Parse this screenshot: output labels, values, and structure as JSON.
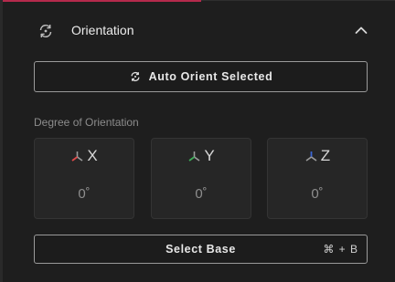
{
  "panel": {
    "title": "Orientation",
    "colors": {
      "accent": "#b42a4c",
      "axis_x": "#e04a4a",
      "axis_y": "#3fae5a",
      "axis_z": "#3a66d6"
    }
  },
  "header": {
    "icon": "rotate-icon",
    "collapse_icon": "chevron-up-icon"
  },
  "auto_orient": {
    "label": "Auto Orient Selected",
    "icon": "rotate-icon"
  },
  "degree_section": {
    "label": "Degree of Orientation",
    "axes": [
      {
        "letter": "X",
        "value": "0˚",
        "icon": "axis-x-icon"
      },
      {
        "letter": "Y",
        "value": "0˚",
        "icon": "axis-y-icon"
      },
      {
        "letter": "Z",
        "value": "0˚",
        "icon": "axis-z-icon"
      }
    ]
  },
  "select_base": {
    "label": "Select Base",
    "shortcut": "⌘ + B"
  }
}
